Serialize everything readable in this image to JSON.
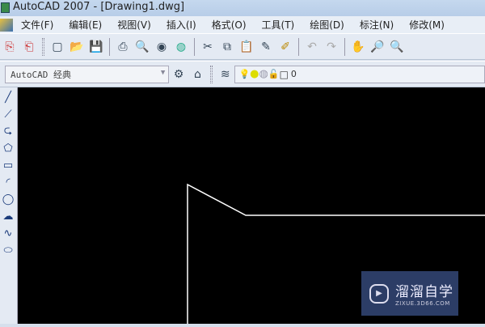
{
  "title": "AutoCAD 2007 - [Drawing1.dwg]",
  "menu": [
    "文件(F)",
    "编辑(E)",
    "视图(V)",
    "插入(I)",
    "格式(O)",
    "工具(T)",
    "绘图(D)",
    "标注(N)",
    "修改(M)"
  ],
  "workspace": {
    "value": "AutoCAD 经典"
  },
  "layer": {
    "value": "0"
  },
  "watermark": {
    "name": "溜溜自学",
    "url": "ZIXUE.3D66.COM"
  }
}
